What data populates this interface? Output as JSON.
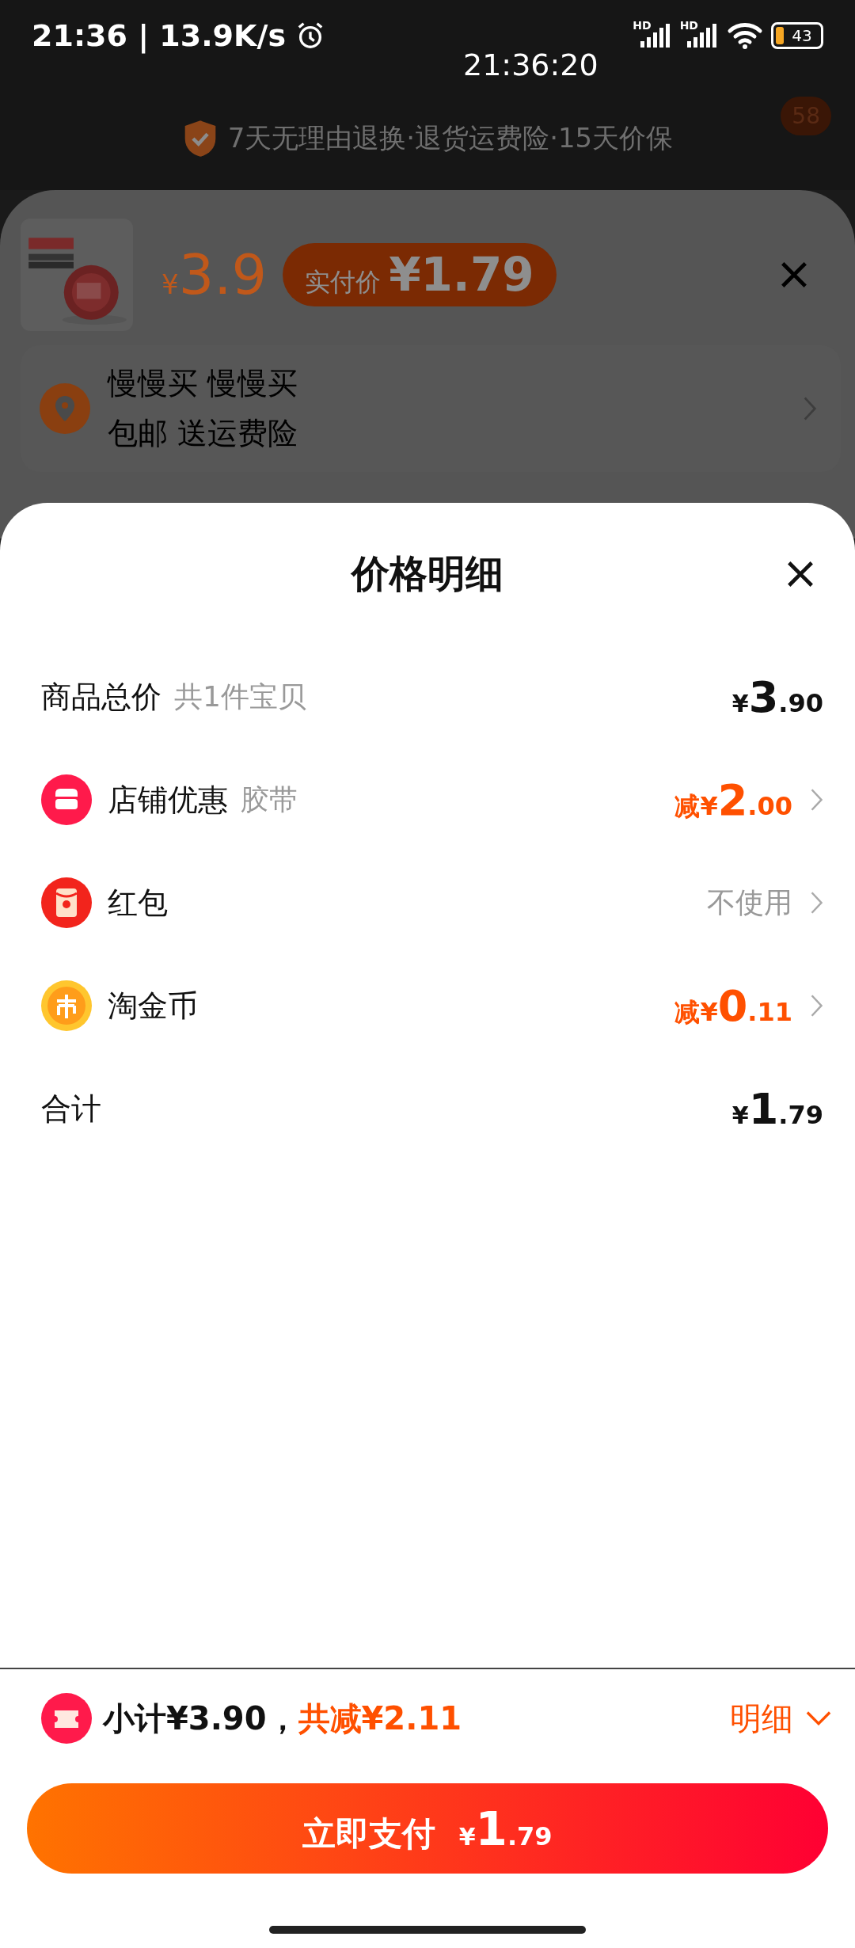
{
  "status_bar": {
    "time": "21:36 | 13.9K/s",
    "clock_overlay": "21:36:20",
    "signal_labels": [
      "HD",
      "HD"
    ],
    "battery": "43"
  },
  "background": {
    "service_text": "7天无理由退换·退货运费险·15天价保",
    "badge": "58",
    "product": {
      "price": "¥3.9",
      "pay_label": "实付价",
      "pay_price": "¥1.79"
    },
    "address": {
      "name": "慢慢买 慢慢买",
      "note": "包邮 送运费险"
    }
  },
  "sheet": {
    "title": "价格明细",
    "rows": [
      {
        "kind": "plain",
        "label": "商品总价",
        "sub": "共1件宝贝",
        "value": "¥3.90"
      },
      {
        "kind": "discount",
        "label": "店铺优惠",
        "sub": "胶带",
        "value": "减¥2.00"
      },
      {
        "kind": "option",
        "label": "红包",
        "value": "不使用"
      },
      {
        "kind": "discount",
        "label": "淘金币",
        "value": "减¥0.11"
      },
      {
        "kind": "plain",
        "label": "合计",
        "value": "¥1.79"
      }
    ]
  },
  "footer": {
    "subtotal": "小计¥3.90，",
    "total_discount": "共减¥2.11",
    "details_link": "明细",
    "pay_button": {
      "label": "立即支付",
      "amount": "¥1.79"
    }
  }
}
